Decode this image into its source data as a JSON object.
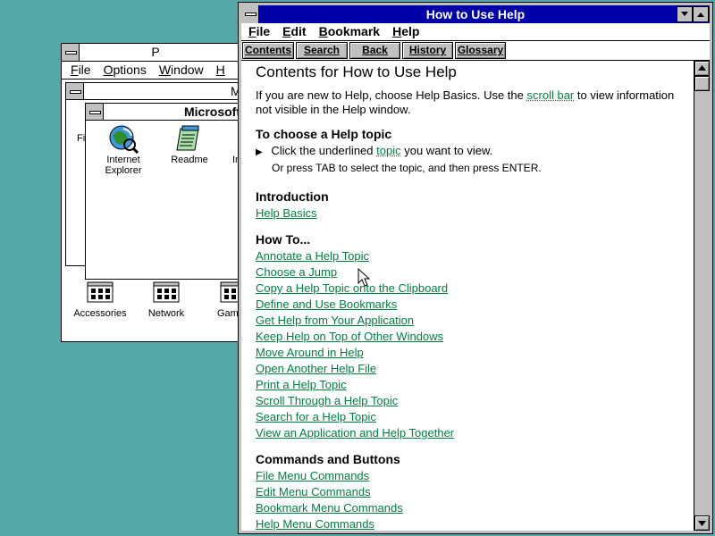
{
  "program_manager": {
    "title": "P",
    "menu": [
      "File",
      "Options",
      "Window",
      "H"
    ],
    "group_window_title": "M",
    "inner_window_title": "Microsoft",
    "side_text_1": "Fi",
    "side_text_2": "In",
    "icons": [
      {
        "label": "Internet Explorer",
        "icon": "internet-explorer-icon"
      },
      {
        "label": "Readme",
        "icon": "notepad-readme-icon"
      }
    ],
    "group_icons": [
      {
        "label": "Accessories",
        "icon": "program-group-icon"
      },
      {
        "label": "Network",
        "icon": "program-group-icon"
      },
      {
        "label": "Gam",
        "icon": "program-group-icon"
      }
    ]
  },
  "help_window": {
    "title": "How to Use Help",
    "menu": [
      "File",
      "Edit",
      "Bookmark",
      "Help"
    ],
    "buttons": [
      {
        "label": "Contents"
      },
      {
        "label": "Search"
      },
      {
        "label": "Back"
      },
      {
        "label": "History"
      },
      {
        "label": "Glossary"
      }
    ],
    "heading": "Contents for How to Use Help",
    "intro_before": "If you are new to Help, choose Help Basics. Use the",
    "intro_link": "scroll bar",
    "intro_after": "to view information",
    "intro_line2": "not visible in the Help window.",
    "choose_heading": "To choose a Help topic",
    "choose_bullet_before": "Click the underlined",
    "choose_bullet_link": "topic",
    "choose_bullet_after": "you want to view.",
    "choose_line2": "Or press TAB to select the topic, and then press ENTER.",
    "introduction_heading": "Introduction",
    "introduction_links": [
      "Help Basics"
    ],
    "howto_heading": "How To...",
    "howto_links": [
      "Annotate a Help Topic",
      "Choose a Jump",
      "Copy a Help Topic onto the Clipboard",
      "Define and Use Bookmarks",
      "Get Help from Your Application",
      "Keep Help on Top of Other Windows",
      "Move Around in Help",
      "Open Another Help File",
      "Print a Help Topic",
      "Scroll Through a Help Topic",
      "Search for a Help Topic",
      "View an Application and Help Together"
    ],
    "commands_heading": "Commands and Buttons",
    "commands_links": [
      "File Menu Commands",
      "Edit Menu Commands",
      "Bookmark Menu Commands",
      "Help Menu Commands"
    ]
  },
  "colors": {
    "desktop": "#55a8a8",
    "active_title": "#0000a8",
    "link": "#008040",
    "button_face": "#c0c0c0"
  }
}
